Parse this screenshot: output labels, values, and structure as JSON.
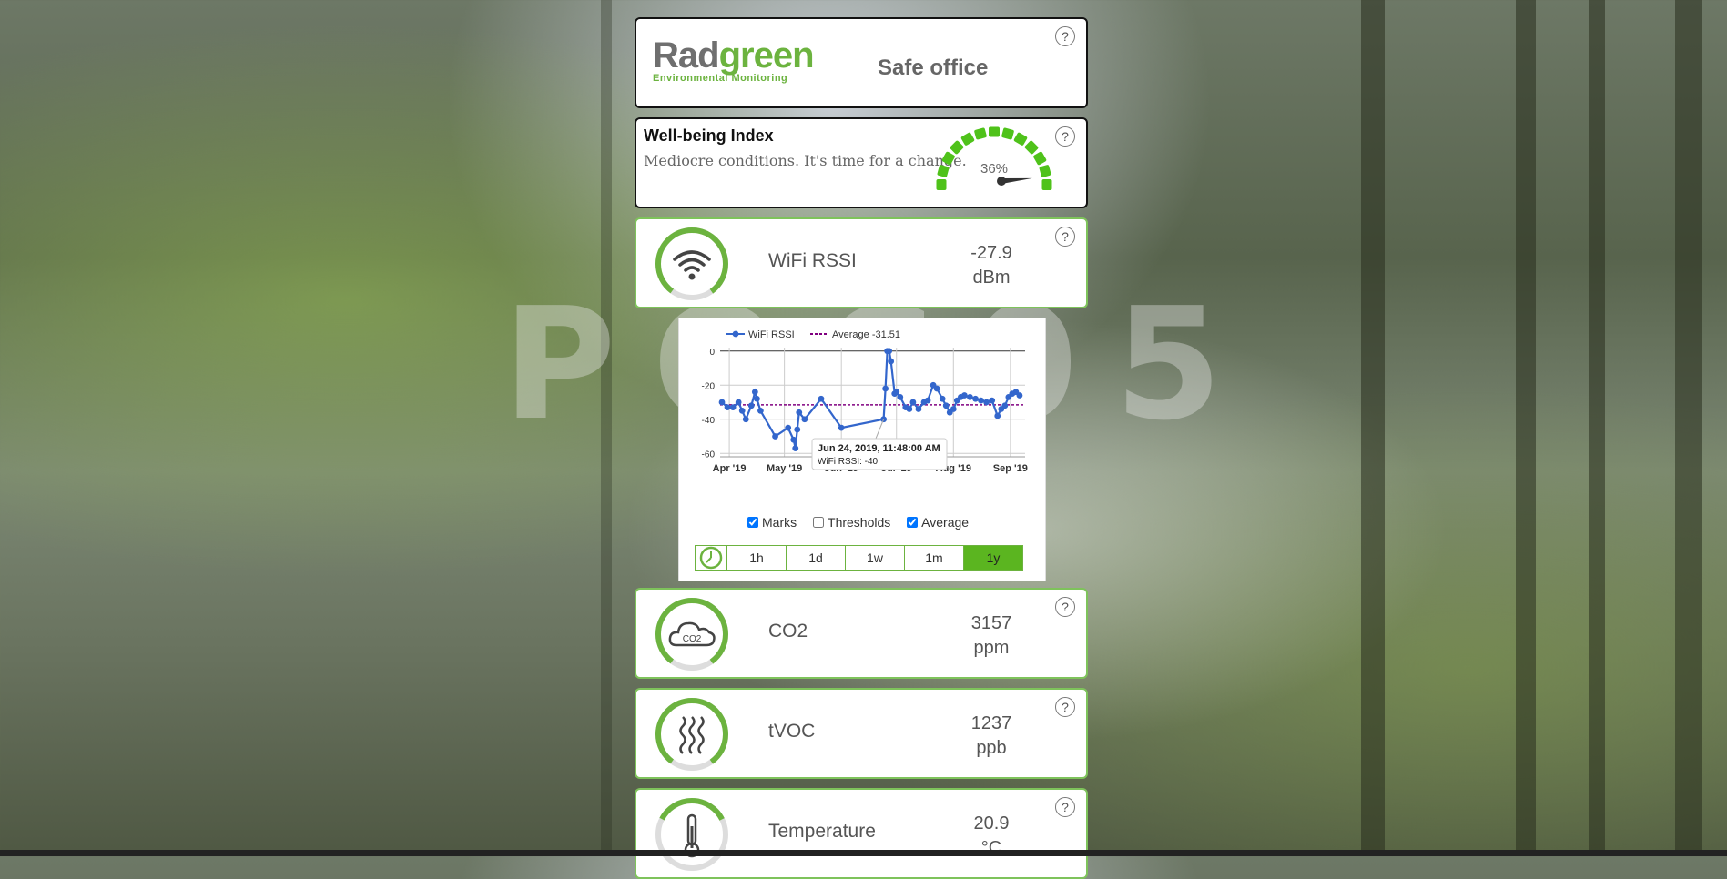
{
  "header": {
    "logo_text_main": "Radgreen",
    "logo_text_sub": "Environmental Monitoring",
    "location": "Safe office",
    "help": "?"
  },
  "wellbeing": {
    "title": "Well-being Index",
    "description": "Mediocre conditions. It's time for a change.",
    "percent_label": "36%",
    "percent": 36,
    "help": "?"
  },
  "watermark": "POC05",
  "sensors": [
    {
      "name": "WiFi RSSI",
      "value": "-27.9",
      "unit": "dBm",
      "icon": "wifi-icon",
      "help": "?",
      "ring_fraction": 0.8
    },
    {
      "name": "CO2",
      "value": "3157",
      "unit": "ppm",
      "icon": "cloud-co2-icon",
      "help": "?",
      "ring_fraction": 0.8
    },
    {
      "name": "tVOC",
      "value": "1237",
      "unit": "ppb",
      "icon": "tvoc-waves-icon",
      "help": "?",
      "ring_fraction": 0.8
    },
    {
      "name": "Temperature",
      "value": "20.9",
      "unit": "°C",
      "icon": "thermometer-icon",
      "help": "?",
      "ring_fraction": 0.35
    }
  ],
  "chart_controls": {
    "checkboxes": [
      {
        "label": "Marks",
        "checked": true
      },
      {
        "label": "Thresholds",
        "checked": false
      },
      {
        "label": "Average",
        "checked": true
      }
    ],
    "ranges": [
      "1h",
      "1d",
      "1w",
      "1m",
      "1y"
    ],
    "active_range": "1y"
  },
  "chart_data": {
    "type": "line",
    "series": [
      {
        "name": "WiFi RSSI",
        "color": "#3366cc",
        "x": [
          "2019-03-28",
          "2019-03-31",
          "2019-04-03",
          "2019-04-06",
          "2019-04-08",
          "2019-04-10",
          "2019-04-13",
          "2019-04-15",
          "2019-04-16",
          "2019-04-18",
          "2019-04-26",
          "2019-05-03",
          "2019-05-06",
          "2019-05-07",
          "2019-05-08",
          "2019-05-09",
          "2019-05-12",
          "2019-05-21",
          "2019-06-01",
          "2019-06-24",
          "2019-06-25",
          "2019-06-26",
          "2019-06-27",
          "2019-06-28",
          "2019-06-30",
          "2019-07-01",
          "2019-07-03",
          "2019-07-06",
          "2019-07-08",
          "2019-07-10",
          "2019-07-13",
          "2019-07-16",
          "2019-07-18",
          "2019-07-21",
          "2019-07-23",
          "2019-07-26",
          "2019-07-28",
          "2019-07-30",
          "2019-08-01",
          "2019-08-03",
          "2019-08-05",
          "2019-08-07",
          "2019-08-10",
          "2019-08-13",
          "2019-08-16",
          "2019-08-19",
          "2019-08-22",
          "2019-08-25",
          "2019-08-27",
          "2019-08-29",
          "2019-08-31",
          "2019-09-02",
          "2019-09-04",
          "2019-09-06"
        ],
        "y": [
          -30,
          -33,
          -33,
          -30,
          -35,
          -40,
          -32,
          -24,
          -28,
          -35,
          -50,
          -45,
          -52,
          -57,
          -46,
          -36,
          -40,
          -28,
          -45,
          -40,
          -22,
          0,
          0,
          -6,
          -25,
          -24,
          -27,
          -33,
          -34,
          -30,
          -34,
          -30,
          -29,
          -20,
          -22,
          -28,
          -32,
          -36,
          -34,
          -29,
          -27,
          -26,
          -27,
          -28,
          -29,
          -30,
          -29,
          -38,
          -34,
          -32,
          -27,
          -25,
          -24,
          -26
        ]
      },
      {
        "name": "Average -31.51",
        "color": "#800080",
        "dashed": true,
        "y_constant": -31.51
      }
    ],
    "x_ticks": [
      "Apr '19",
      "May '19",
      "Jun '19",
      "Jul '19",
      "Aug '19",
      "Sep '19"
    ],
    "y_ticks": [
      0,
      -20,
      -40,
      -60
    ],
    "ylim": [
      -62,
      2
    ],
    "xlim": [
      "2019-03-27",
      "2019-09-09"
    ],
    "grid": true,
    "legend": "top-left",
    "tooltip": {
      "title": "Jun 24, 2019, 11:48:00 AM",
      "text": "WiFi RSSI: -40",
      "x": "2019-06-24",
      "y": -40
    }
  }
}
